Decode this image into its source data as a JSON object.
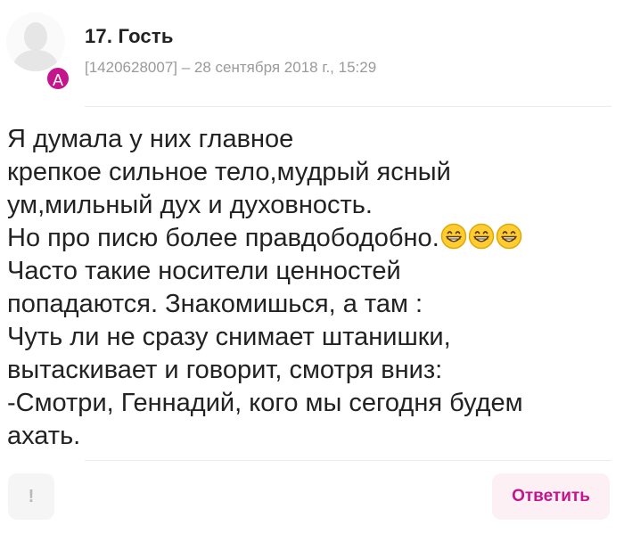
{
  "comment": {
    "avatar_badge": "А",
    "author": "17. Гость",
    "meta": "[1420628007] – 28 сентября 2018 г., 15:29",
    "body_lines": [
      "Я думала у них главное",
      "крепкое сильное тело,мудрый ясный",
      "ум,мильный дух и духовность.",
      "Но про писю более правдободобно.",
      "Часто такие носители ценностей",
      "попадаются. Знакомишься, а там :",
      "Чуть ли не сразу снимает штанишки,",
      "вытаскивает и говорит, смотря вниз:",
      "-Смотри, Геннадий, кого мы сегодня будем",
      "ахать."
    ],
    "emoji_icon": "grinning-face-icon",
    "emoji_count": 3
  },
  "actions": {
    "report_label": "!",
    "reply_label": "Ответить"
  },
  "colors": {
    "accent": "#c4158c",
    "reply_bg": "#fdf0f5",
    "meta_text": "#9a9a9a"
  }
}
